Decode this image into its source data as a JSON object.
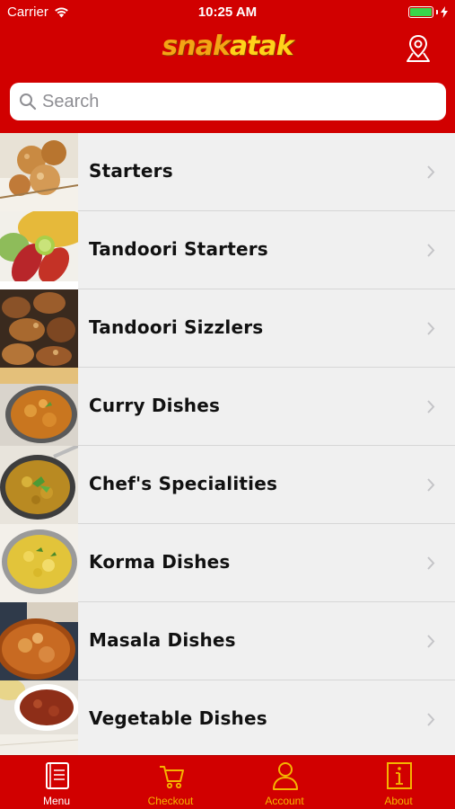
{
  "status_bar": {
    "carrier": "Carrier",
    "time": "10:25 AM"
  },
  "nav": {
    "logo_part1": "snak",
    "logo_part2": "atak",
    "location_icon": "map-pin-icon"
  },
  "search": {
    "placeholder": "Search",
    "value": ""
  },
  "menu": {
    "items": [
      {
        "label": "Starters",
        "thumb": "starters"
      },
      {
        "label": "Tandoori Starters",
        "thumb": "tandoori-starters"
      },
      {
        "label": "Tandoori Sizzlers",
        "thumb": "tandoori-sizzlers"
      },
      {
        "label": "Curry Dishes",
        "thumb": "curry"
      },
      {
        "label": "Chef's Specialities",
        "thumb": "chefs"
      },
      {
        "label": "Korma Dishes",
        "thumb": "korma"
      },
      {
        "label": "Masala Dishes",
        "thumb": "masala"
      },
      {
        "label": "Vegetable Dishes",
        "thumb": "vegetable"
      }
    ]
  },
  "tab_bar": {
    "tabs": [
      {
        "label": "Menu",
        "icon": "menu-book-icon",
        "active": true
      },
      {
        "label": "Checkout",
        "icon": "cart-icon",
        "active": false
      },
      {
        "label": "Account",
        "icon": "person-icon",
        "active": false
      },
      {
        "label": "About",
        "icon": "info-icon",
        "active": false
      }
    ]
  },
  "colors": {
    "brand_red": "#d10000",
    "tab_active": "#ffffff",
    "tab_inactive": "#f5b400",
    "list_bg": "#f0f0f0"
  }
}
